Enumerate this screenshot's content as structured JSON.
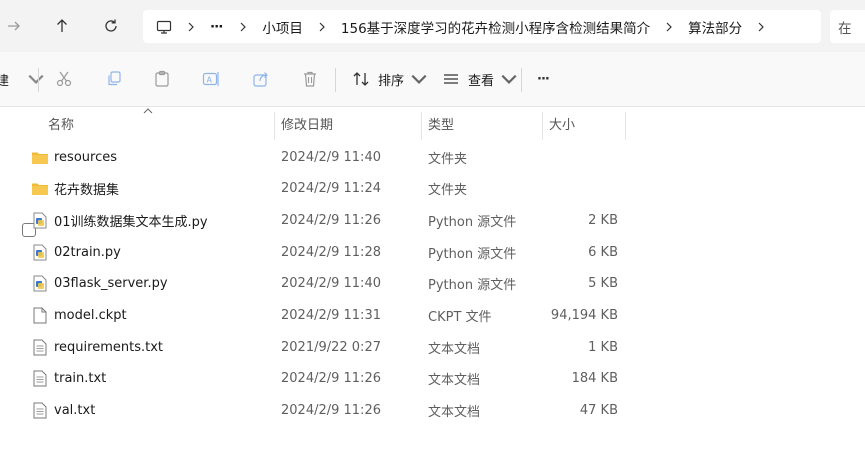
{
  "nav": {
    "crumbs": [
      "小项目",
      "156基于深度学习的花卉检测小程序含检测结果简介",
      "算法部分"
    ],
    "ellipsis": "···",
    "search_placeholder": "在"
  },
  "toolbar": {
    "new_label_fragment": "建",
    "sort_label": "排序",
    "view_label": "查看",
    "more_label": "···"
  },
  "columns": {
    "name": "名称",
    "date": "修改日期",
    "type": "类型",
    "size": "大小"
  },
  "files": [
    {
      "name": "resources",
      "date": "2024/2/9 11:40",
      "type": "文件夹",
      "size": "",
      "icon": "folder-icon"
    },
    {
      "name": "花卉数据集",
      "date": "2024/2/9 11:24",
      "type": "文件夹",
      "size": "",
      "icon": "folder-icon"
    },
    {
      "name": "01训练数据集文本生成.py",
      "date": "2024/2/9 11:26",
      "type": "Python 源文件",
      "size": "2 KB",
      "icon": "python-file-icon"
    },
    {
      "name": "02train.py",
      "date": "2024/2/9 11:28",
      "type": "Python 源文件",
      "size": "6 KB",
      "icon": "python-file-icon"
    },
    {
      "name": "03flask_server.py",
      "date": "2024/2/9 11:40",
      "type": "Python 源文件",
      "size": "5 KB",
      "icon": "python-file-icon"
    },
    {
      "name": "model.ckpt",
      "date": "2024/2/9 11:31",
      "type": "CKPT 文件",
      "size": "94,194 KB",
      "icon": "generic-file-icon"
    },
    {
      "name": "requirements.txt",
      "date": "2021/9/22 0:27",
      "type": "文本文档",
      "size": "1 KB",
      "icon": "text-file-icon"
    },
    {
      "name": "train.txt",
      "date": "2024/2/9 11:26",
      "type": "文本文档",
      "size": "184 KB",
      "icon": "text-file-icon"
    },
    {
      "name": "val.txt",
      "date": "2024/2/9 11:26",
      "type": "文本文档",
      "size": "47 KB",
      "icon": "text-file-icon"
    }
  ],
  "colors": {
    "folder": "#f7c34b",
    "python_icon": "#3b78c9",
    "toolbar_disabled": "#9a9a9a"
  }
}
